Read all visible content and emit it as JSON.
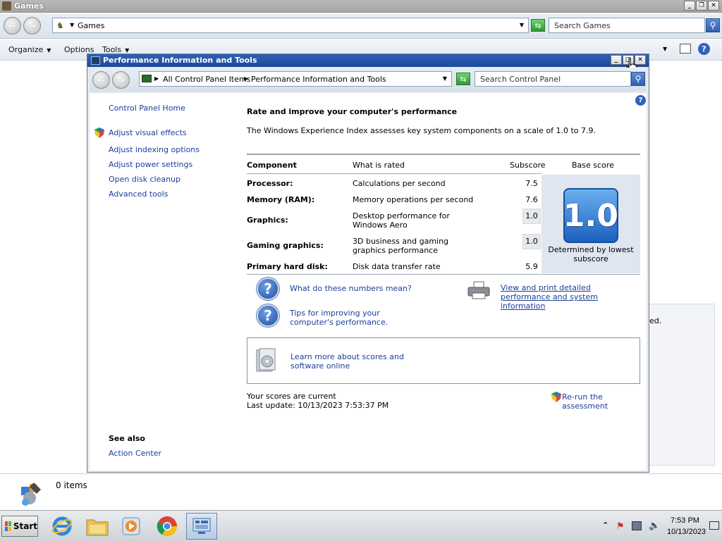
{
  "games_window": {
    "title": "Games",
    "address": "Games",
    "search_placeholder": "Search Games",
    "toolbar": {
      "organize": "Organize",
      "options": "Options",
      "tools": "Tools"
    },
    "right_panel_text": "ed.",
    "status_text": "0 items"
  },
  "perf_window": {
    "title": "Performance Information and Tools",
    "breadcrumb": [
      "All Control Panel Items",
      "Performance Information and Tools"
    ],
    "search_placeholder": "Search Control Panel",
    "sidebar": {
      "home": "Control Panel Home",
      "items": [
        "Adjust visual effects",
        "Adjust indexing options",
        "Adjust power settings",
        "Open disk cleanup",
        "Advanced tools"
      ],
      "see_also_heading": "See also",
      "see_also_items": [
        "Action Center"
      ]
    },
    "main": {
      "heading": "Rate and improve your computer's performance",
      "intro": "The Windows Experience Index assesses key system components on a scale of 1.0 to 7.9.",
      "table": {
        "headers": [
          "Component",
          "What is rated",
          "Subscore",
          "Base score"
        ],
        "rows": [
          {
            "component": "Processor:",
            "rated": "Calculations per second",
            "subscore": "7.5"
          },
          {
            "component": "Memory (RAM):",
            "rated": "Memory operations per second",
            "subscore": "7.6"
          },
          {
            "component": "Graphics:",
            "rated": "Desktop performance for Windows Aero",
            "subscore": "1.0"
          },
          {
            "component": "Gaming graphics:",
            "rated": "3D business and gaming graphics performance",
            "subscore": "1.0"
          },
          {
            "component": "Primary hard disk:",
            "rated": "Disk data transfer rate",
            "subscore": "5.9"
          }
        ],
        "base_score": "1.0",
        "base_caption": "Determined by lowest subscore"
      },
      "help_links": [
        "What do these numbers mean?",
        "Tips for improving your computer's performance."
      ],
      "print_link": "View and print detailed performance and system information",
      "learn_more": "Learn more about scores and software online",
      "status_current": "Your scores are current",
      "last_update": "Last update: 10/13/2023 7:53:37 PM",
      "rerun": "Re-run the assessment"
    }
  },
  "taskbar": {
    "start_label": "Start",
    "clock_time": "7:53 PM",
    "clock_date": "10/13/2023"
  },
  "colors": {
    "link": "#1a3e9a",
    "title_active": "#1b4a9c",
    "score_badge": "#1d5fbf"
  }
}
